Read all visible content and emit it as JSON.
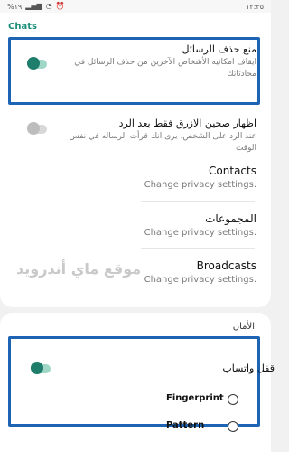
{
  "status": {
    "time": "١٢:٣٥",
    "battery": "%١٩",
    "left_icons": [
      "wifi-icon",
      "signal-icon",
      "alarm-icon"
    ]
  },
  "section": {
    "title": "Chats"
  },
  "rows": [
    {
      "title": "منع حذف الرسائل",
      "subtitle": "ايقاف امكانيه الأشخاص الآخرين من حذف الرسائل في محادثاتك",
      "toggle": "on"
    },
    {
      "title": "اظهار صحين الازرق فقط بعد الرد",
      "subtitle": "عند الرد على الشخص، يرى انك قرأت الرساله في نفس الوقت",
      "toggle": "off"
    },
    {
      "title": "Contacts",
      "subtitle": "Change privacy settings."
    },
    {
      "title": "المجموعات",
      "subtitle": "Change privacy settings."
    },
    {
      "title": "Broadcasts",
      "subtitle": "Change privacy settings."
    }
  ],
  "watermark": "موقع ماي أندرويد",
  "security": {
    "title": "الأمان",
    "lock": {
      "title": "قفل واتساب",
      "toggle": "on"
    },
    "options": [
      {
        "label": "Fingerprint",
        "selected": false
      },
      {
        "label": "Pattern",
        "selected": false
      }
    ]
  },
  "colors": {
    "accent": "#1f7d6b",
    "highlight": "#1e64b4"
  }
}
